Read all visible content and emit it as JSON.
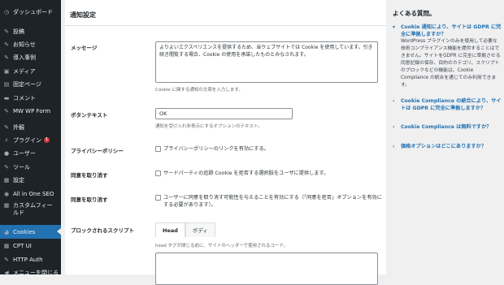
{
  "sidebar": {
    "items": [
      {
        "icon": "dashboard-icon",
        "glyph": "◷",
        "label": "ダッシュボード"
      },
      {
        "icon": "pin-icon",
        "glyph": "✎",
        "label": "投稿"
      },
      {
        "icon": "megaphone-icon",
        "glyph": "✎",
        "label": "お知らせ"
      },
      {
        "icon": "pin-icon",
        "glyph": "✎",
        "label": "導入事例"
      },
      {
        "icon": "media-icon",
        "glyph": "▣",
        "label": "メディア"
      },
      {
        "icon": "page-icon",
        "glyph": "▤",
        "label": "固定ページ"
      },
      {
        "icon": "comment-icon",
        "glyph": "▬",
        "label": "コメント"
      },
      {
        "icon": "pin-icon",
        "glyph": "✎",
        "label": "MW WP Form"
      },
      {
        "icon": "brush-icon",
        "glyph": "✎",
        "label": "外観"
      },
      {
        "icon": "plugin-icon",
        "glyph": "⚡",
        "label": "プラグイン",
        "badge": "1"
      },
      {
        "icon": "user-icon",
        "glyph": "●",
        "label": "ユーザー"
      },
      {
        "icon": "wrench-icon",
        "glyph": "✎",
        "label": "ツール"
      },
      {
        "icon": "settings-icon",
        "glyph": "▦",
        "label": "設定"
      },
      {
        "icon": "seo-icon",
        "glyph": "◉",
        "label": "All in One SEO"
      },
      {
        "icon": "grid-icon",
        "glyph": "▦",
        "label": "カスタムフィールド"
      },
      {
        "icon": "cookie-icon",
        "glyph": "◕",
        "label": "Cookies"
      },
      {
        "icon": "grid-icon",
        "glyph": "▦",
        "label": "CPT UI"
      },
      {
        "icon": "pin-icon",
        "glyph": "✎",
        "label": "HTTP Auth"
      },
      {
        "icon": "collapse-icon",
        "glyph": "◀",
        "label": "メニューを閉じる"
      }
    ]
  },
  "main": {
    "title": "通知設定",
    "message_label": "メッセージ",
    "message_value": "よりよいエクスペリエンスを提供するため、当ウェブサイトでは Cookie を使用しています。引き続き閲覧する場合、Cookie の使用を承諾したものとみなされます。",
    "message_desc": "Cookie に関する通知の文章を入力します。",
    "button_label": "ボタンテキスト",
    "button_value": "OK",
    "button_desc": "通知を受け入れ非表示にするオプションのテキスト。",
    "privacy_label": "プライバシーポリシー",
    "privacy_cb": "プライバシーポリシーのリンクを有効にする。",
    "refuse_label": "同意を取り消す",
    "refuse_cb": "サードパーティの追跡 Cookie を拒否する選択肢をユーザに提供します。",
    "revoke_label": "同意を取り消す",
    "revoke_cb": "ユーザーに同意を取り消す可能性を与えることを有効にする（「同意を拒否」オプションを有効にする必要があります）。",
    "blocked_label": "ブロックされるスクリプト",
    "tab_head": "Head",
    "tab_body": "ボディ",
    "blocked_desc": "head タグが閉じる前に、サイトのヘッダーで使用されるコード。"
  },
  "faq": {
    "title": "よくある質問。",
    "q1": "Cookie 通知により、サイトは GDPR に完全に準拠しますか？",
    "a1": "WordPress プラグインのみを使用して必要な技術コンプライアンス機能を提供することはできません。サイトをGDPR に完全に準拠させる同意記録の保存、目的のカテゴリ、スクリプトのブロックなどの機能は、Cookie Compliance の統合を通じてのみ利用できます。",
    "q2": "Cookie Compliance の統合により、サイトは GDPR に完全に準拠しますか？",
    "q3": "Cookie Compliance は無料ですか？",
    "q4": "価格オプションはどこにありますか？"
  }
}
